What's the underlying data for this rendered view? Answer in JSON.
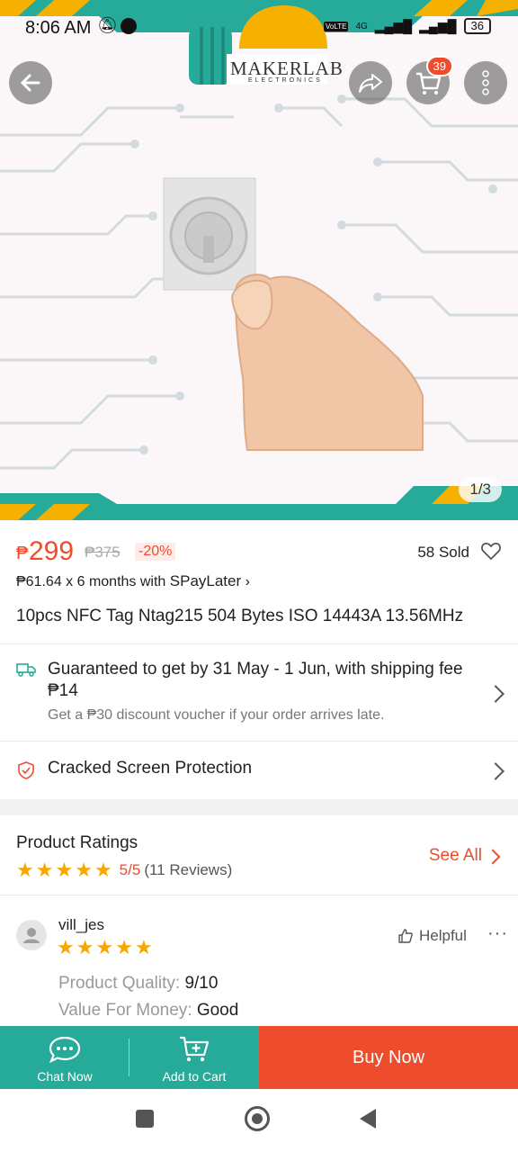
{
  "status_bar": {
    "time": "8:06 AM",
    "network": "4G",
    "battery": "36"
  },
  "brand": {
    "name": "MAKERLAB",
    "subtitle": "ELECTRONICS"
  },
  "header": {
    "cart_count": "39",
    "image_pager": "1/3"
  },
  "product": {
    "currency": "₱",
    "price": "299",
    "original_price": "₱375",
    "discount": "-20%",
    "sold": "58 Sold",
    "installment_prefix": "₱61.64 x 6 months with ",
    "installment_brand": "SPayLater",
    "title": "10pcs NFC Tag Ntag215 504 Bytes ISO 14443A 13.56MHz"
  },
  "shipping": {
    "guarantee": "Guaranteed to get by 31 May - 1 Jun, with shipping fee ₱14",
    "voucher": "Get a ₱30 discount voucher if your order arrives late."
  },
  "protection": {
    "label": "Cracked Screen Protection"
  },
  "ratings": {
    "heading": "Product Ratings",
    "score": "5/5",
    "count": "(11 Reviews)",
    "see_all": "See All",
    "stars": 5
  },
  "review": {
    "user": "vill_jes",
    "stars": 5,
    "helpful": "Helpful",
    "quality_label": "Product Quality: ",
    "quality_value": "9/10",
    "value_label": "Value For Money: ",
    "value_value": "Good"
  },
  "bottom_bar": {
    "chat": "Chat Now",
    "cart": "Add to Cart",
    "buy": "Buy Now"
  },
  "colors": {
    "accent": "#ee4d2d",
    "teal": "#26aa99",
    "star": "#f6a700"
  }
}
